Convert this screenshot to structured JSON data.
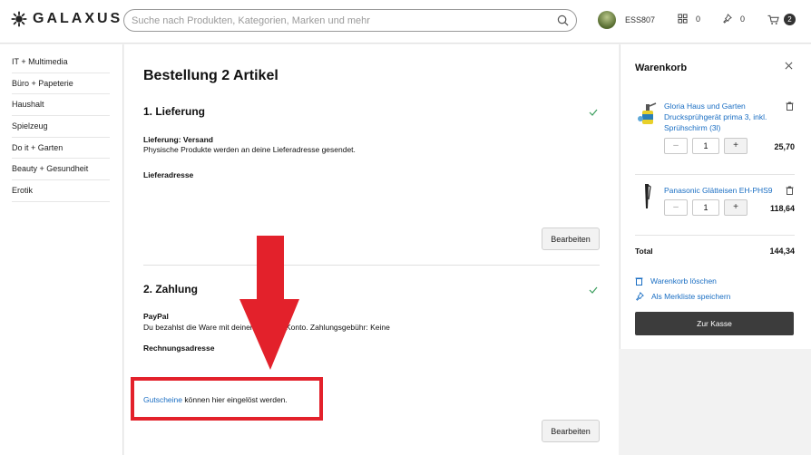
{
  "header": {
    "logo_text": "GALAXUS",
    "search_placeholder": "Suche nach Produkten, Kategorien, Marken und mehr",
    "username": "ESS807",
    "compare_count": "0",
    "wishlist_count": "0",
    "cart_count": "2"
  },
  "sidebar": {
    "items": [
      {
        "label": "IT + Multimedia"
      },
      {
        "label": "Büro + Papeterie"
      },
      {
        "label": "Haushalt"
      },
      {
        "label": "Spielzeug"
      },
      {
        "label": "Do it + Garten"
      },
      {
        "label": "Beauty + Gesundheit"
      },
      {
        "label": "Erotik"
      }
    ]
  },
  "order": {
    "title": "Bestellung 2 Artikel",
    "delivery": {
      "heading": "1. Lieferung",
      "method_label": "Lieferung: Versand",
      "method_text": "Physische Produkte werden an deine Lieferadresse gesendet.",
      "address_label": "Lieferadresse",
      "edit_button": "Bearbeiten"
    },
    "payment": {
      "heading": "2. Zahlung",
      "method_label": "PayPal",
      "method_text": "Du bezahlst die Ware mit deinem PayPal-Konto. Zahlungsgebühr: Keine",
      "address_label": "Rechnungsadresse",
      "voucher_link": "Gutscheine",
      "voucher_text": " können hier eingelöst werden.",
      "edit_button": "Bearbeiten"
    }
  },
  "cart": {
    "title": "Warenkorb",
    "items": [
      {
        "name": "Gloria Haus und Garten Drucksprühgerät prima 3, inkl. Sprühschirm (3l)",
        "quantity": "1",
        "price": "25,70",
        "minus": "–",
        "plus": "+"
      },
      {
        "name": "Panasonic Glätteisen EH-PHS9",
        "quantity": "1",
        "price": "118,64",
        "minus": "–",
        "plus": "+"
      }
    ],
    "total_label": "Total",
    "total_value": "144,34",
    "clear_label": "Warenkorb löschen",
    "save_label": "Als Merkliste speichern",
    "checkout_label": "Zur Kasse"
  },
  "colors": {
    "link": "#1a6ec3",
    "check": "#3a9d5d",
    "annotation": "#e3212b",
    "checkout_bg": "#3c3c3c"
  }
}
